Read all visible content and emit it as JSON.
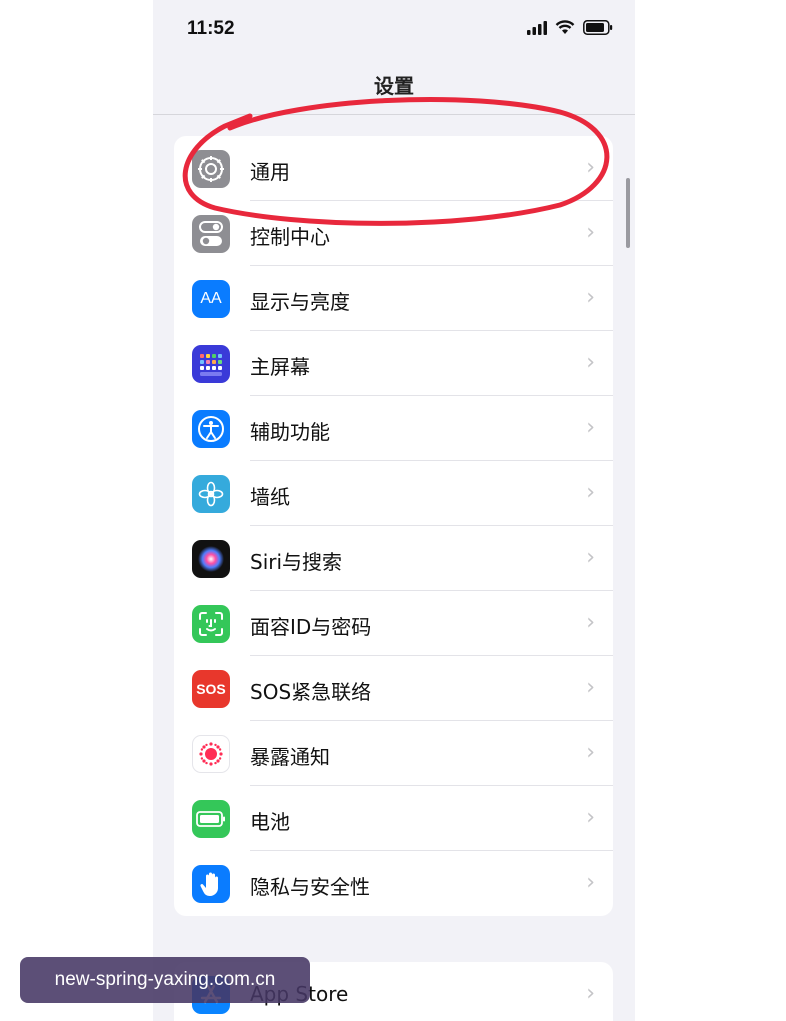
{
  "status_bar": {
    "time": "11:52",
    "icons": [
      "signal-icon",
      "wifi-icon",
      "battery-icon"
    ]
  },
  "nav": {
    "title": "设置"
  },
  "settings": [
    {
      "label": "通用",
      "icon": "gear-icon",
      "color": "#8e8e93"
    },
    {
      "label": "控制中心",
      "icon": "toggles-icon",
      "color": "#8e8e93"
    },
    {
      "label": "显示与亮度",
      "icon": "text-size-icon",
      "color": "#0a7cff",
      "glyph": "AA"
    },
    {
      "label": "主屏幕",
      "icon": "home-screen-grid-icon",
      "color": "#3a3ad8"
    },
    {
      "label": "辅助功能",
      "icon": "accessibility-icon",
      "color": "#0a7cff"
    },
    {
      "label": "墙纸",
      "icon": "flower-icon",
      "color": "#35aadc"
    },
    {
      "label": "Siri与搜索",
      "icon": "siri-icon",
      "color": "#111111"
    },
    {
      "label": "面容ID与密码",
      "icon": "face-id-icon",
      "color": "#34c759"
    },
    {
      "label": "SOS紧急联络",
      "icon": "sos-icon",
      "color": "#e8372c",
      "glyph": "SOS"
    },
    {
      "label": "暴露通知",
      "icon": "exposure-icon",
      "color": "#ffffff"
    },
    {
      "label": "电池",
      "icon": "battery-setting-icon",
      "color": "#34c759"
    },
    {
      "label": "隐私与安全性",
      "icon": "hand-icon",
      "color": "#0a7cff"
    }
  ],
  "second_group": [
    {
      "label": "App Store",
      "icon": "app-store-icon",
      "color": "#0a84ff"
    }
  ],
  "annotation": {
    "color": "#e8283c"
  },
  "watermark": {
    "text": "new-spring-yaxing.com.cn"
  }
}
